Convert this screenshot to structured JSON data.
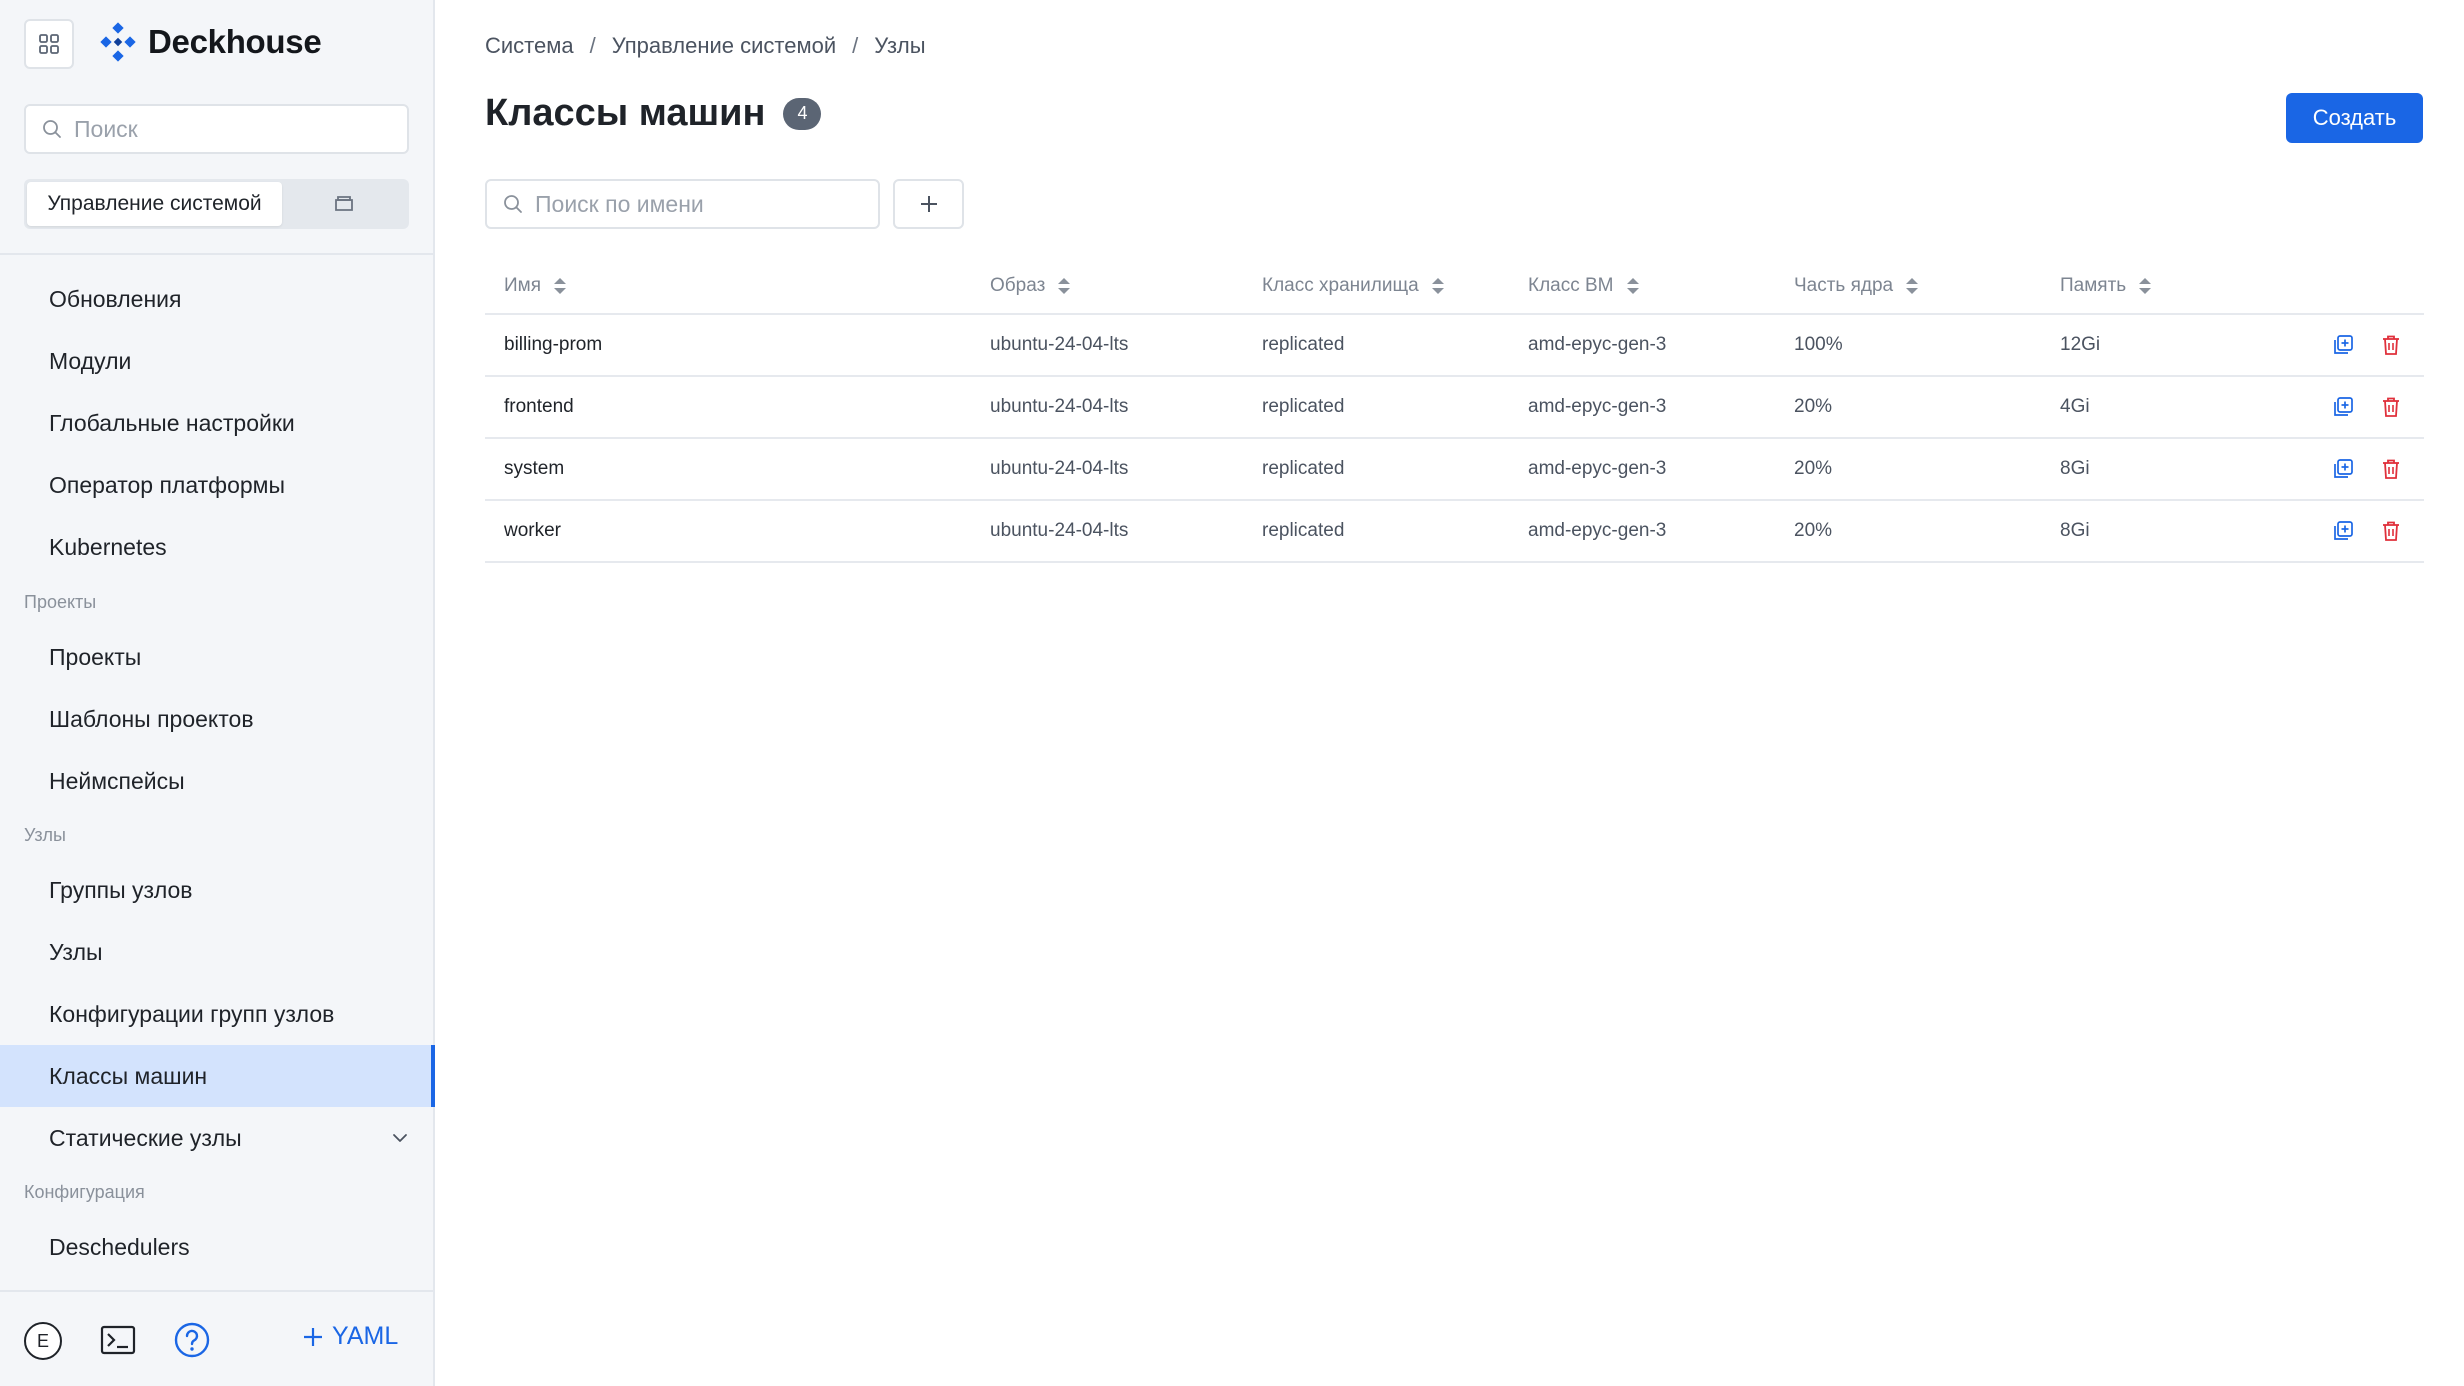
{
  "app": {
    "name": "Deckhouse"
  },
  "sidebar": {
    "search_placeholder": "Поиск",
    "segment": {
      "active": "Управление системой"
    },
    "items_top": [
      {
        "label": "Обновления"
      },
      {
        "label": "Модули"
      },
      {
        "label": "Глобальные настройки"
      },
      {
        "label": "Оператор платформы"
      },
      {
        "label": "Kubernetes"
      }
    ],
    "section_projects": "Проекты",
    "items_projects": [
      {
        "label": "Проекты"
      },
      {
        "label": "Шаблоны проектов"
      },
      {
        "label": "Неймспейсы"
      }
    ],
    "section_nodes": "Узлы",
    "items_nodes": [
      {
        "label": "Группы узлов"
      },
      {
        "label": "Узлы"
      },
      {
        "label": "Конфигурации групп узлов"
      },
      {
        "label": "Классы машин"
      },
      {
        "label": "Статические узлы"
      }
    ],
    "section_config": "Конфигурация",
    "items_config": [
      {
        "label": "Deschedulers"
      }
    ],
    "active_item": "Классы машин",
    "bottom": {
      "avatar_letter": "E",
      "yaml_label": "YAML"
    }
  },
  "breadcrumb": [
    "Система",
    "Управление системой",
    "Узлы"
  ],
  "page": {
    "title": "Классы машин",
    "count": "4",
    "create_label": "Создать"
  },
  "filter": {
    "search_placeholder": "Поиск по имени"
  },
  "table": {
    "columns": [
      "Имя",
      "Образ",
      "Класс хранилища",
      "Класс ВМ",
      "Часть ядра",
      "Память"
    ],
    "rows": [
      {
        "name": "billing-prom",
        "image": "ubuntu-24-04-lts",
        "storage_class": "replicated",
        "vm_class": "amd-epyc-gen-3",
        "core_fraction": "100%",
        "memory": "12Gi"
      },
      {
        "name": "frontend",
        "image": "ubuntu-24-04-lts",
        "storage_class": "replicated",
        "vm_class": "amd-epyc-gen-3",
        "core_fraction": "20%",
        "memory": "4Gi"
      },
      {
        "name": "system",
        "image": "ubuntu-24-04-lts",
        "storage_class": "replicated",
        "vm_class": "amd-epyc-gen-3",
        "core_fraction": "20%",
        "memory": "8Gi"
      },
      {
        "name": "worker",
        "image": "ubuntu-24-04-lts",
        "storage_class": "replicated",
        "vm_class": "amd-epyc-gen-3",
        "core_fraction": "20%",
        "memory": "8Gi"
      }
    ]
  },
  "colors": {
    "accent": "#1a66e5",
    "danger": "#e0303b",
    "active_nav_bg": "#d3e3fd"
  }
}
